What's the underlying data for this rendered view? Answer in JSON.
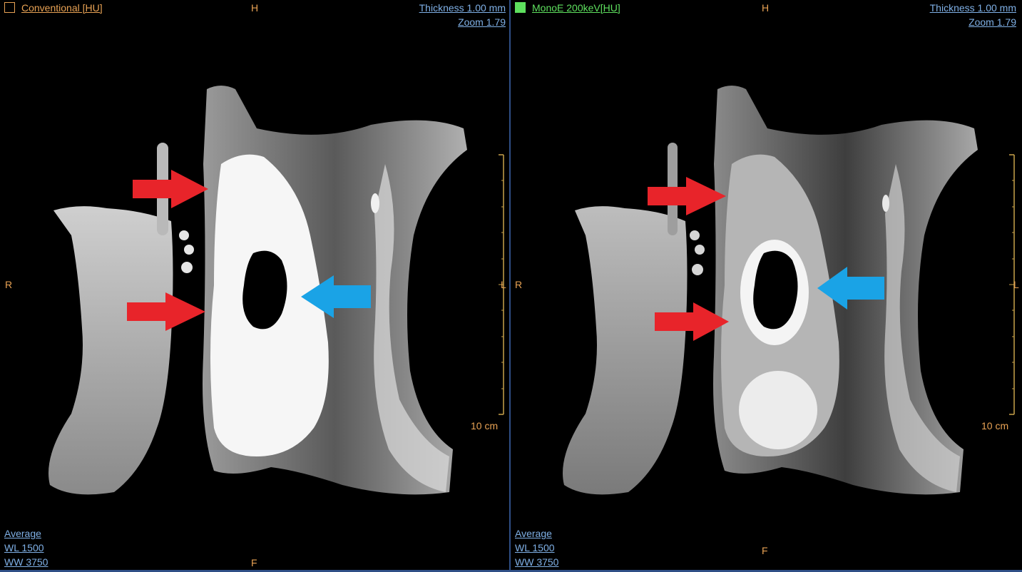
{
  "viewports": [
    {
      "series_label": "Conventional [HU]",
      "swatch_color": "#e8a254",
      "orientation": {
        "top": "H",
        "bottom": "F",
        "left": "R",
        "right": "L"
      },
      "thickness": "Thickness 1.00 mm",
      "zoom": "Zoom 1.79",
      "scale_label": "10 cm",
      "projection": "Average",
      "wl": "WL  1500",
      "ww": "WW  3750"
    },
    {
      "series_label": "MonoE 200keV[HU]",
      "swatch_color": "#5ee05e",
      "orientation": {
        "top": "H",
        "bottom": "F",
        "left": "R",
        "right": "L"
      },
      "thickness": "Thickness 1.00 mm",
      "zoom": "Zoom 1.79",
      "scale_label": "10 cm",
      "projection": "Average",
      "wl": "WL  1500",
      "ww": "WW  3750"
    }
  ],
  "colors": {
    "annotation_red": "#e8242a",
    "annotation_blue": "#1aa3e6",
    "overlay_orange": "#e8a254",
    "overlay_blue": "#7fb0e6",
    "viewport_border": "#2f4f86"
  }
}
